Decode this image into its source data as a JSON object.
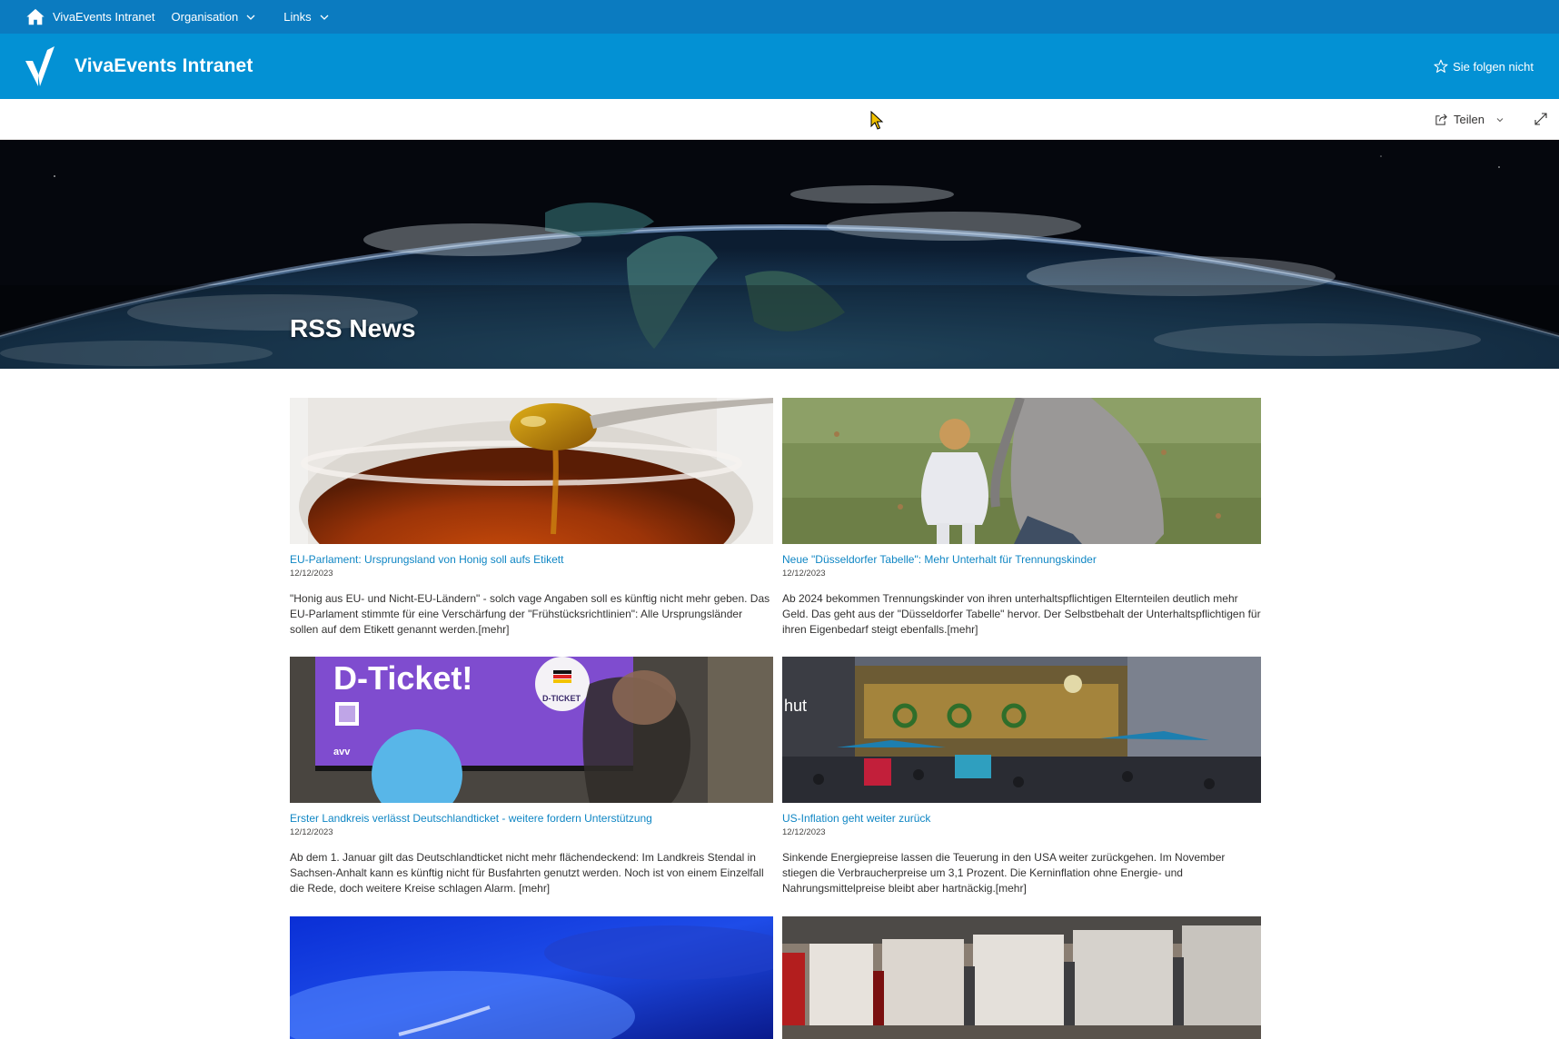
{
  "suite_bar": {
    "site_name": "VivaEvents Intranet",
    "nav": [
      {
        "label": "Organisation"
      },
      {
        "label": "Links"
      }
    ]
  },
  "header": {
    "title": "VivaEvents Intranet",
    "follow_label": "Sie folgen nicht"
  },
  "command_bar": {
    "share_label": "Teilen"
  },
  "hero": {
    "title": "RSS News"
  },
  "news": [
    {
      "title": "EU-Parlament: Ursprungsland von Honig soll aufs Etikett",
      "date": "12/12/2023",
      "description": "\"Honig aus EU- und Nicht-EU-Ländern\" - solch vage Angaben soll es künftig nicht mehr geben. Das EU-Parlament stimmte für eine Verschärfung der \"Frühstücksrichtlinien\": Alle Ursprungsländer sollen auf dem Etikett genannt werden.[mehr]"
    },
    {
      "title": "Neue \"Düsseldorfer Tabelle\": Mehr Unterhalt für Trennungskinder",
      "date": "12/12/2023",
      "description": "Ab 2024 bekommen Trennungskinder von ihren unterhaltspflichtigen Elternteilen deutlich mehr Geld. Das geht aus der \"Düsseldorfer Tabelle\" hervor. Der Selbstbehalt der Unterhaltspflichtigen für ihren Eigenbedarf steigt ebenfalls.[mehr]"
    },
    {
      "title": "Erster Landkreis verlässt Deutschlandticket - weitere fordern Unterstützung",
      "date": "12/12/2023",
      "description": "Ab dem 1. Januar gilt das Deutschlandticket nicht mehr flächendeckend: Im Landkreis Stendal in Sachsen-Anhalt kann es künftig nicht für Busfahrten genutzt werden. Noch ist von einem Einzelfall die Rede, doch weitere Kreise schlagen Alarm. [mehr]",
      "image_text": {
        "headline": "D-Ticket!",
        "badge": "D-TICKET",
        "brand": "avv"
      }
    },
    {
      "title": "US-Inflation geht weiter zurück",
      "date": "12/12/2023",
      "description": "Sinkende Energiepreise lassen die Teuerung in den USA weiter zurückgehen. Im November stiegen die Verbraucherpreise um 3,1 Prozent. Die Kerninflation ohne Energie- und Nahrungsmittelpreise bleibt aber hartnäckig.[mehr]",
      "image_text": {
        "sign": "hut"
      }
    },
    {
      "title": "",
      "date": "",
      "description": ""
    },
    {
      "title": "",
      "date": "",
      "description": ""
    }
  ]
}
